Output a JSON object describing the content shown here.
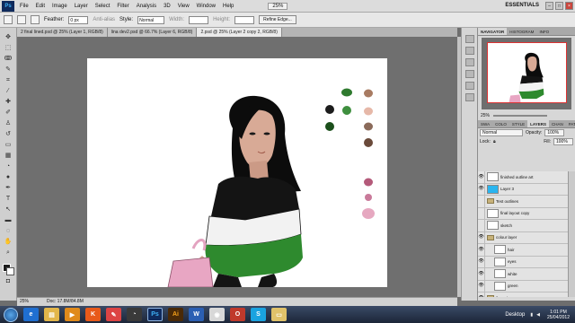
{
  "app": {
    "logo": "Ps"
  },
  "menubar": {
    "items": [
      "File",
      "Edit",
      "Image",
      "Layer",
      "Select",
      "Filter",
      "Analysis",
      "3D",
      "View",
      "Window",
      "Help"
    ],
    "zoom": "25%",
    "workspace": "ESSENTIALS"
  },
  "options": {
    "feather_label": "Feather:",
    "feather_value": "0 px",
    "antialias_label": "Anti-alias",
    "style_label": "Style:",
    "style_value": "Normal",
    "width_label": "Width:",
    "height_label": "Height:",
    "refine_edge": "Refine Edge..."
  },
  "doc_tabs": [
    {
      "label": "2 final lined.psd @ 25% (Layer 1, RGB/8)",
      "active": false
    },
    {
      "label": "lina dev2.psd @ 66.7% (Layer 6, RGB/8)",
      "active": false
    },
    {
      "label": "2.psd @ 25% (Layer 2 copy 2, RGB/8)",
      "active": true
    }
  ],
  "status": {
    "zoom": "25%",
    "doc": "Doc: 17.8M/84.8M"
  },
  "panels": {
    "top_tabs": [
      "NAVIGATOR",
      "HISTOGRAM",
      "INFO"
    ],
    "nav_zoom": "25%",
    "mid_tabs": [
      "SWA",
      "COLO",
      "STYLE",
      "LAYERS",
      "CHAN",
      "PATH"
    ],
    "blend_mode": "Normal",
    "opacity_label": "Opacity:",
    "opacity_value": "100%",
    "lock_label": "Lock:",
    "fill_label": "Fill:",
    "fill_value": "100%"
  },
  "layers": [
    {
      "name": "finished outline art",
      "type": "layer",
      "visible": true,
      "indent": false,
      "selected": false,
      "blue": false
    },
    {
      "name": "Layer 3",
      "type": "layer",
      "visible": true,
      "indent": false,
      "selected": false,
      "blue": true
    },
    {
      "name": "Test outlines",
      "type": "group",
      "visible": false,
      "indent": false,
      "selected": false,
      "blue": false
    },
    {
      "name": "final layout copy",
      "type": "layer",
      "visible": false,
      "indent": false,
      "selected": false,
      "blue": false
    },
    {
      "name": "sketch",
      "type": "layer",
      "visible": false,
      "indent": false,
      "selected": false,
      "blue": false
    },
    {
      "name": "colour layer",
      "type": "group",
      "visible": true,
      "indent": false,
      "selected": false,
      "blue": false
    },
    {
      "name": "hair",
      "type": "layer",
      "visible": true,
      "indent": true,
      "selected": false,
      "blue": false
    },
    {
      "name": "eyes",
      "type": "layer",
      "visible": true,
      "indent": true,
      "selected": false,
      "blue": false
    },
    {
      "name": "white",
      "type": "layer",
      "visible": true,
      "indent": true,
      "selected": false,
      "blue": false
    },
    {
      "name": "green",
      "type": "layer",
      "visible": true,
      "indent": true,
      "selected": false,
      "blue": false
    },
    {
      "name": "flat colour",
      "type": "group",
      "visible": true,
      "indent": false,
      "selected": false,
      "blue": false
    },
    {
      "name": "eyes",
      "type": "layer",
      "visible": true,
      "indent": true,
      "selected": false,
      "blue": false
    }
  ],
  "palette_colors": [
    "#2f7a2f",
    "#1c1c1c",
    "#3f8f3f",
    "#1b4f1b",
    "#a87b62",
    "#e6b8a8",
    "#8a6a5a",
    "#6a4a3a",
    "#b45a7a",
    "#c97a9a",
    "#e6a8c0"
  ],
  "taskbar": {
    "apps": [
      "IE",
      "Explorer",
      "Media",
      "K",
      "Paint",
      "Chrome2",
      "Ps",
      "Ai",
      "Word",
      "Chrome",
      "Opera",
      "Skype",
      "Files"
    ],
    "desktop_label": "Desktop",
    "time": "1:01 PM",
    "date": "25/04/2012"
  }
}
